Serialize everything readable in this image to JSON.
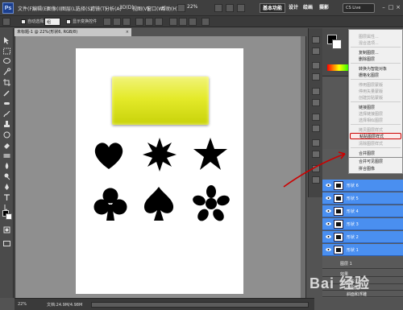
{
  "app": {
    "logo": "Ps",
    "menu": [
      "文件(F)",
      "编辑(E)",
      "图像(I)",
      "图层(L)",
      "选择(S)",
      "滤镜(T)",
      "分析(A)",
      "3D(D)",
      "视图(V)",
      "窗口(W)",
      "帮助(H)"
    ],
    "zoom_menu": "22%",
    "workspaces": [
      "基本功能",
      "设计",
      "绘画",
      "摄影"
    ],
    "search": "CS Live"
  },
  "options_bar": {
    "auto_select_label": "自动选择:",
    "auto_select_value": "组",
    "show_transform_label": "显示变换控件"
  },
  "document": {
    "tab_title": "未标题-1 @ 22%(形状6, RGB/8)",
    "close": "×",
    "status_zoom": "22%",
    "status_doc": "文档:24.9M/4.98M"
  },
  "context_menu": {
    "items": [
      {
        "label": "图层属性...",
        "enabled": false
      },
      {
        "label": "混合选项...",
        "enabled": false
      },
      {
        "label": "复制图层...",
        "enabled": true
      },
      {
        "label": "删除图层",
        "enabled": true
      },
      {
        "label": "转换为智能对象",
        "enabled": true
      },
      {
        "label": "栅格化图层",
        "enabled": true
      },
      {
        "label": "停用图层蒙版",
        "enabled": false
      },
      {
        "label": "停用矢量蒙版",
        "enabled": false
      },
      {
        "label": "创建剪贴蒙版",
        "enabled": false
      },
      {
        "label": "链接图层",
        "enabled": true
      },
      {
        "label": "选择链接图层",
        "enabled": false
      },
      {
        "label": "选择相似图层",
        "enabled": false
      },
      {
        "label": "拷贝图层样式",
        "enabled": false
      },
      {
        "label": "粘贴图层样式",
        "enabled": true,
        "highlighted": true
      },
      {
        "label": "清除图层样式",
        "enabled": false
      },
      {
        "label": "合并图层",
        "enabled": true
      },
      {
        "label": "合并可见图层",
        "enabled": true
      },
      {
        "label": "拼合图像",
        "enabled": true
      }
    ]
  },
  "layers": {
    "selected": [
      "形状 6",
      "形状 5",
      "形状 4",
      "形状 3",
      "形状 2",
      "形状 1"
    ],
    "other": "图层 1",
    "effects": "效果",
    "effect_items": [
      "投影",
      "内阴影",
      "斜面和浮雕"
    ]
  },
  "colors": {
    "highlight_red": "#cc0000",
    "layer_selection": "#4a8ff0",
    "shape_yellow": "#e4ea2a"
  },
  "watermark": "Bai 经验"
}
